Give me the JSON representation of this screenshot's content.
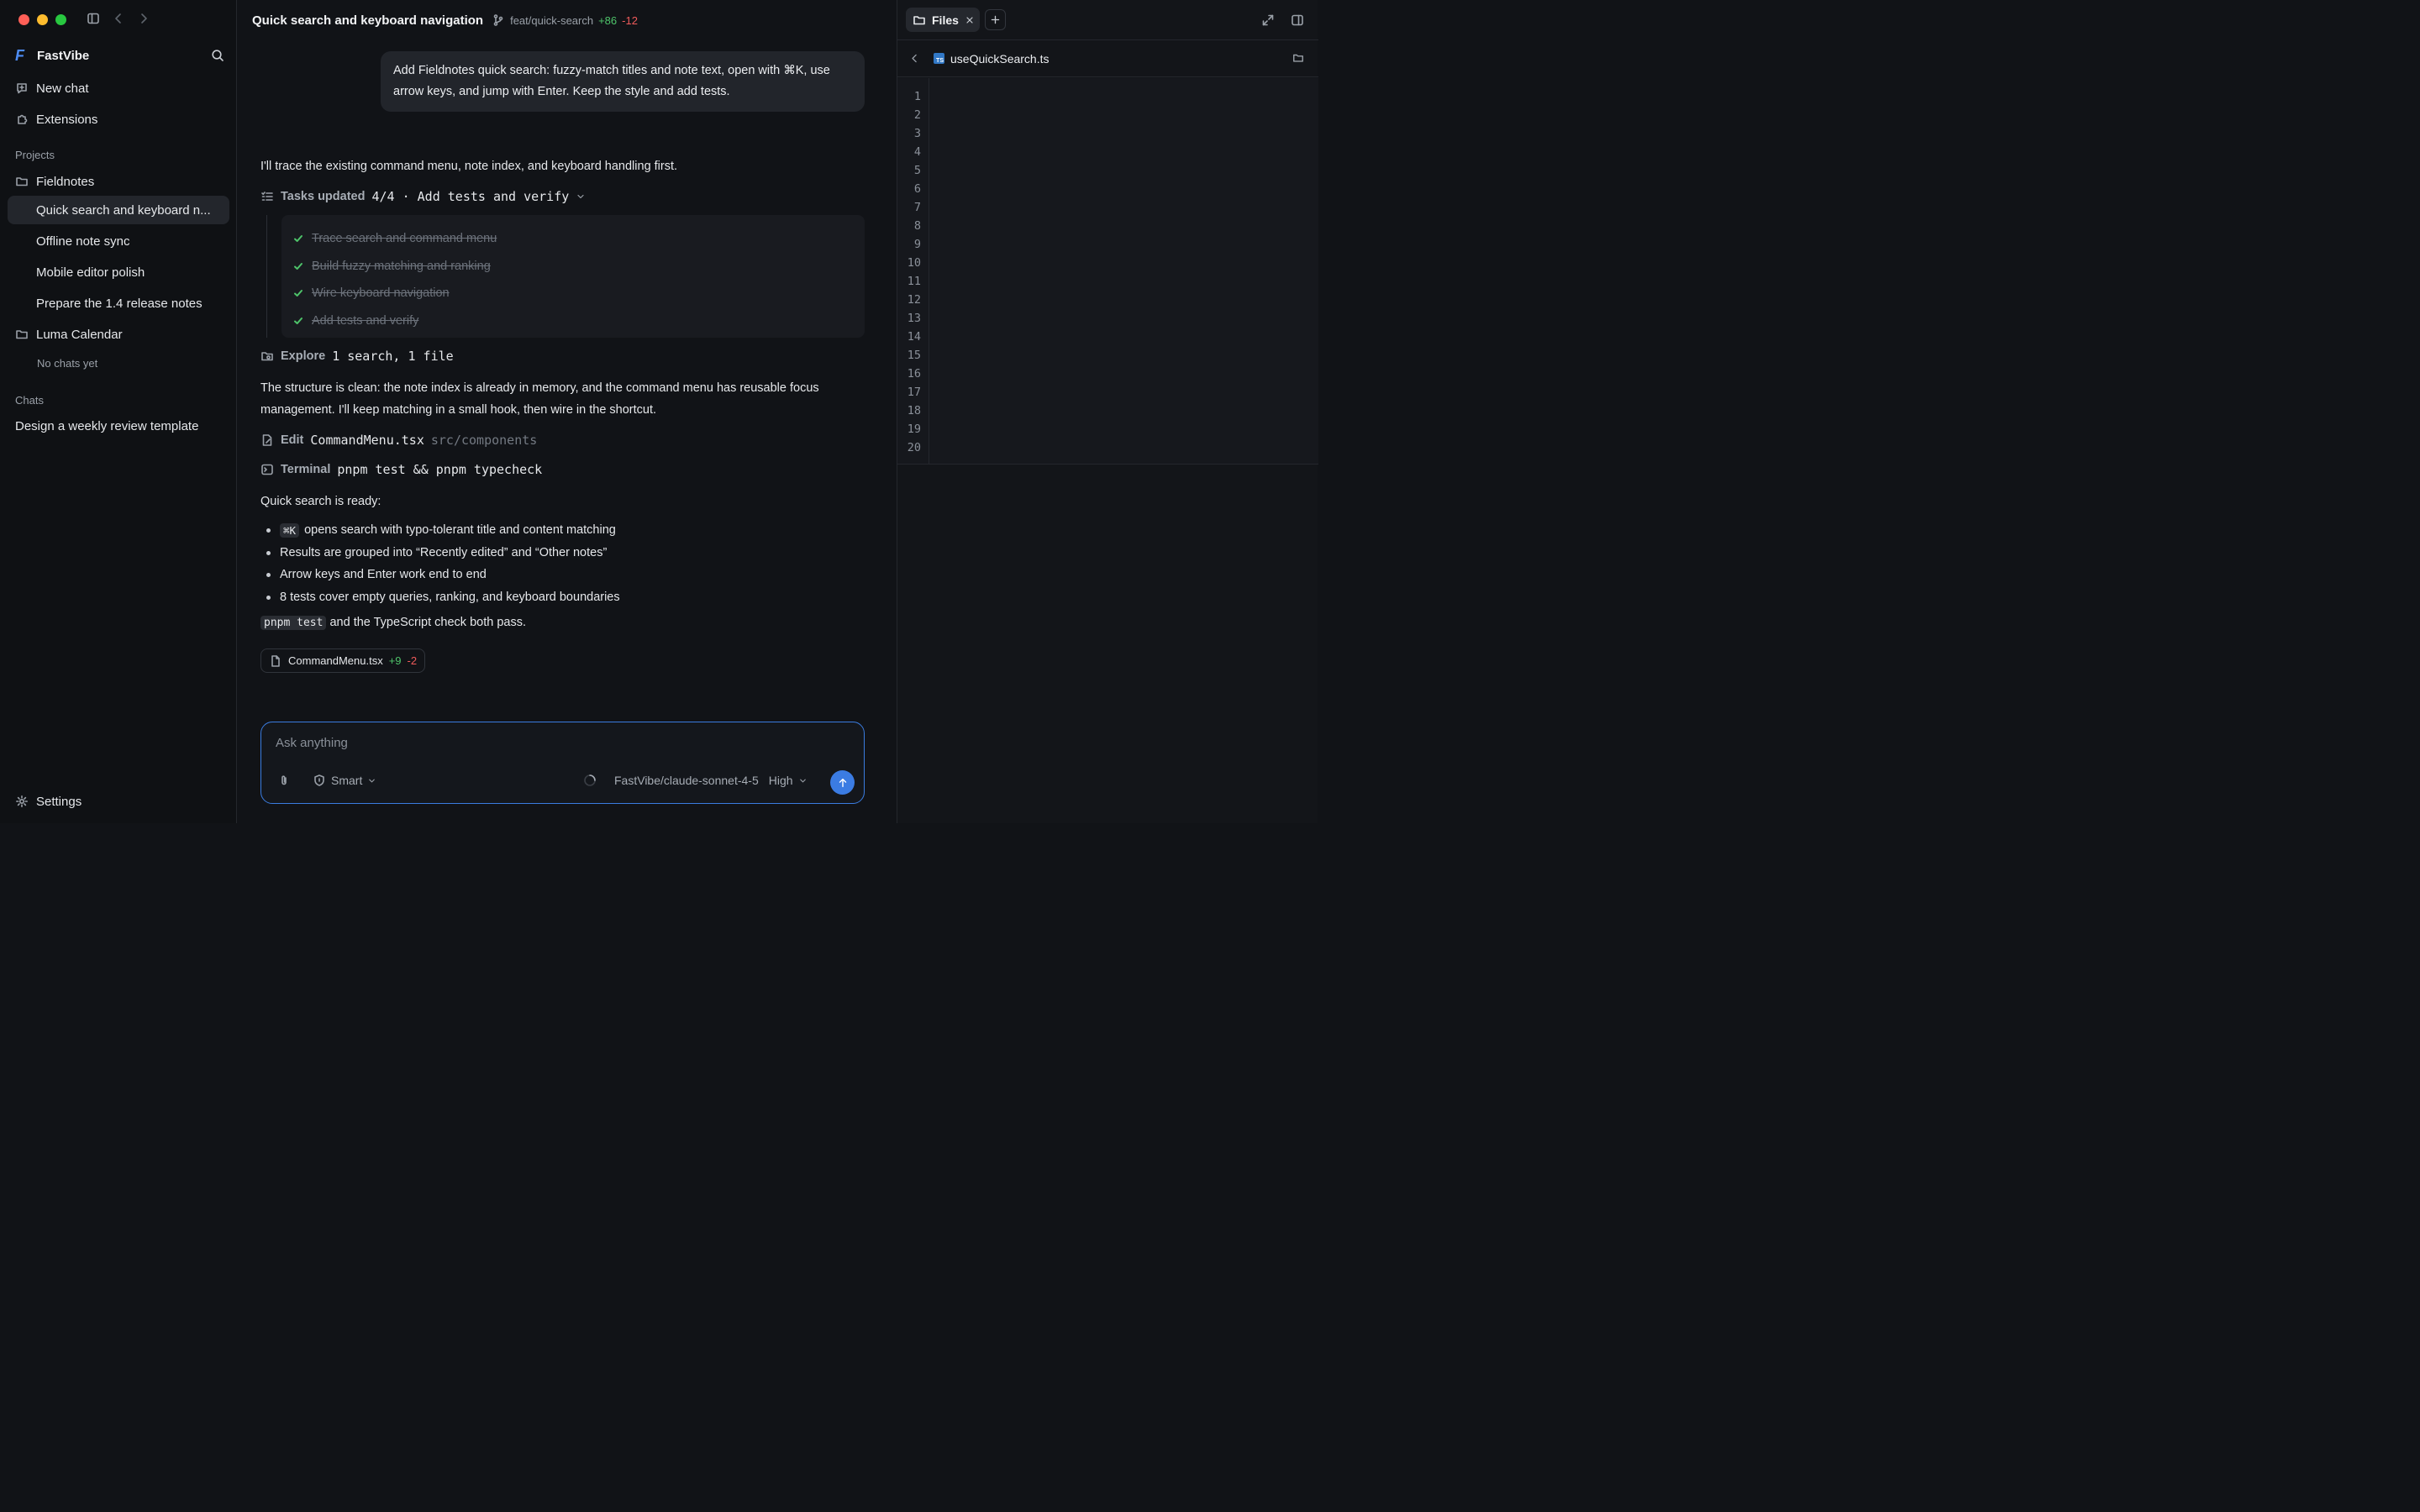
{
  "app": {
    "name": "FastVibe"
  },
  "colors": {
    "accent": "#3b7ce3",
    "added": "#4ec46a",
    "removed": "#ef5b5b"
  },
  "sidebar": {
    "new_chat": "New chat",
    "extensions": "Extensions",
    "projects_label": "Projects",
    "projects": [
      {
        "name": "Fieldnotes",
        "chats": [
          "Quick search and keyboard n...",
          "Offline note sync",
          "Mobile editor polish",
          "Prepare the 1.4 release notes"
        ]
      },
      {
        "name": "Luma Calendar",
        "empty": "No chats yet"
      }
    ],
    "chats_label": "Chats",
    "chats": [
      "Design a weekly review template"
    ],
    "settings": "Settings"
  },
  "main": {
    "title": "Quick search and keyboard navigation",
    "branch": "feat/quick-search",
    "additions": "+86",
    "deletions": "-12",
    "user_message": "Add Fieldnotes quick search: fuzzy-match titles and note text, open with ⌘K, use arrow keys, and jump with Enter. Keep the style and add tests.",
    "intro": "I'll trace the existing command menu, note index, and keyboard handling first.",
    "tasks_label": "Tasks updated",
    "tasks_summary": "4/4 · Add tests and verify",
    "tasks": [
      "Trace search and command menu",
      "Build fuzzy matching and ranking",
      "Wire keyboard navigation",
      "Add tests and verify"
    ],
    "explore_label": "Explore",
    "explore_value": "1 search, 1 file",
    "analysis": "The structure is clean: the note index is already in memory, and the command menu has reusable focus management. I'll keep matching in a small hook, then wire in the shortcut.",
    "edit_label": "Edit",
    "edit_file": "CommandMenu.tsx",
    "edit_path": "src/components",
    "terminal_label": "Terminal",
    "terminal_cmd": "pnpm test && pnpm typecheck",
    "ready": "Quick search is ready:",
    "result_kbd": "⌘K",
    "results": [
      "opens search with typo-tolerant title and content matching",
      "Results are grouped into “Recently edited” and “Other notes”",
      "Arrow keys and Enter work end to end",
      "8 tests cover empty queries, ranking, and keyboard boundaries"
    ],
    "final_code": "pnpm test",
    "final_text": "and the TypeScript check both pass.",
    "chip": {
      "file": "CommandMenu.tsx",
      "additions": "+9",
      "deletions": "-2"
    }
  },
  "composer": {
    "placeholder": "Ask anything",
    "mode": "Smart",
    "model": "FastVibe/claude-sonnet-4-5",
    "effort": "High"
  },
  "panel": {
    "tab": "Files",
    "file": "useQuickSearch.ts",
    "line_numbers": [
      "1",
      "2",
      "3",
      "4",
      "5",
      "6",
      "7",
      "8",
      "9",
      "10",
      "11",
      "12",
      "13",
      "14",
      "15",
      "16",
      "17",
      "18",
      "19",
      "20"
    ]
  }
}
